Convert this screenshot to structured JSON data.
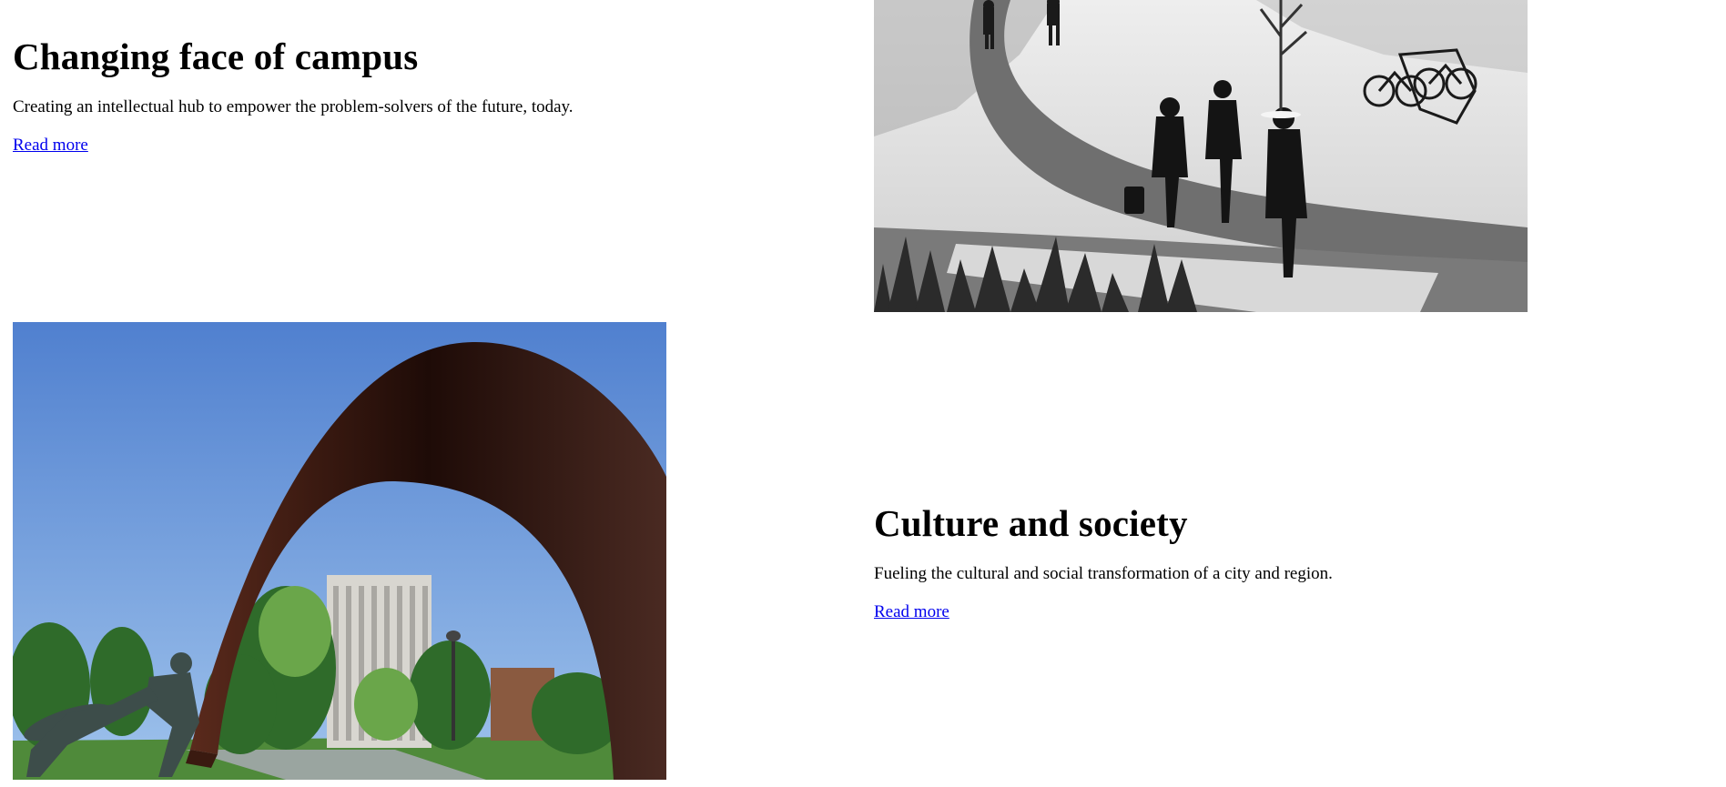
{
  "stories": [
    {
      "heading": "Changing face of campus",
      "description": "Creating an intellectual hub to empower the problem-solvers of the future, today.",
      "link_label": "Read more"
    },
    {
      "heading": "Culture and society",
      "description": "Fueling the cultural and social transformation of a city and region.",
      "link_label": "Read more"
    }
  ],
  "colors": {
    "link": "#0000ee",
    "text": "#000000",
    "background": "#ffffff"
  }
}
